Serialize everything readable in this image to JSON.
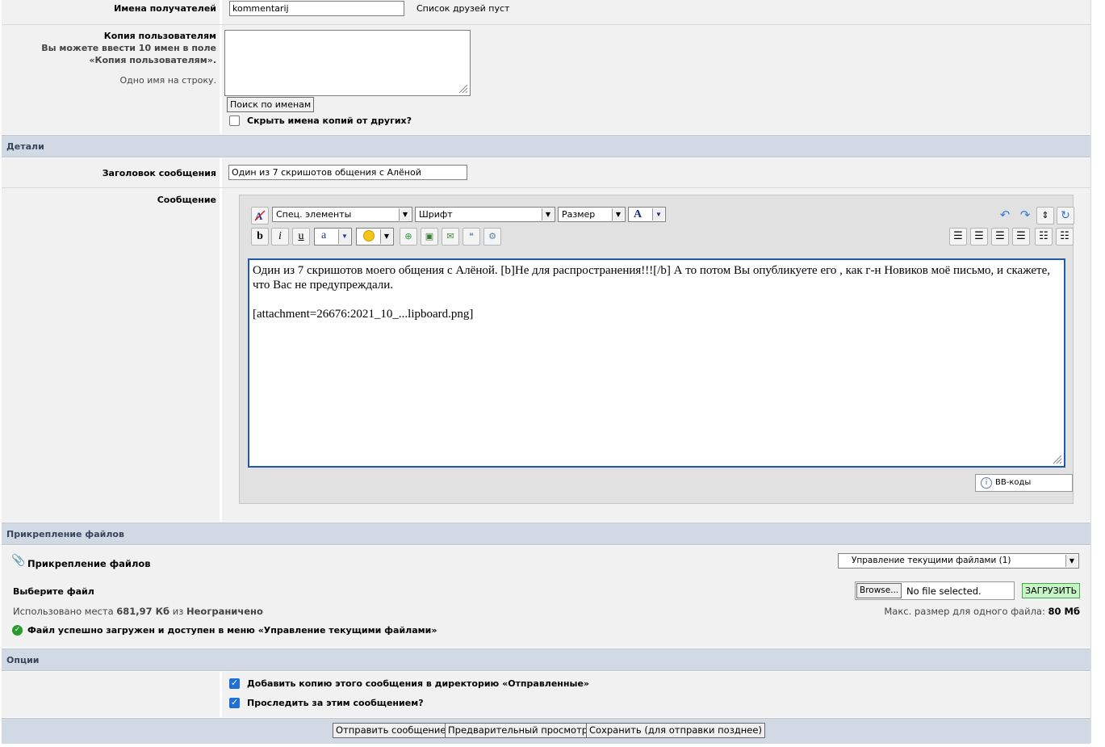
{
  "recipients": {
    "label": "Имена получателей",
    "value": "kommentarij",
    "friends_note": "Список друзей пуст"
  },
  "bcc": {
    "label": "Копия пользователям",
    "hint1": "Вы можете ввести 10 имен в поле «Копия пользователям».",
    "hint2": "Одно имя на строку.",
    "search_button": "Поиск по именам",
    "hide_label": "Скрыть имена копий от других?"
  },
  "details": {
    "section_title": "Детали",
    "subject_label": "Заголовок сообщения",
    "subject_value": "Один из 7 скришотов общения с Алёной",
    "message_label": "Сообщение"
  },
  "editor": {
    "special_select": "Спец. элементы",
    "font_select": "Шрифт",
    "size_select": "Размер",
    "text_line1": "Один из 7 скришотов моего общения с Алёной. [b]Не для распространения!!![/b] А то потом Вы опубликуете его , как г-н Новиков моё письмо, и скажете, что Вас не предупреждали.",
    "text_line2": "[attachment=26676:2021_10_...lipboard.png]",
    "bbcode_button": "BB-коды"
  },
  "attachments": {
    "section_title": "Прикрепление файлов",
    "header_label": "Прикрепление файлов",
    "manage_select": "Управление текущими файлами (1)",
    "choose_label": "Выберите файл",
    "browse_button": "Browse...",
    "file_status": "No file selected.",
    "upload_button": "ЗАГРУЗИТЬ",
    "used_prefix": "Использовано места",
    "used_value": "681,97 Кб",
    "used_mid": "из",
    "used_limit": "Неограничено",
    "max_prefix": "Макс. размер для одного файла:",
    "max_value": "80 Мб",
    "success_msg": "Файл успешно загружен и доступен в меню «Управление текущими файлами»"
  },
  "options": {
    "section_title": "Опции",
    "copy_label": "Добавить копию этого сообщения в директорию «Отправленные»",
    "track_label": "Проследить за этим сообщением?"
  },
  "footer": {
    "send_button": "Отправить сообщение",
    "preview_button": "Предварительный просмотр",
    "save_button": "Сохранить (для отправки позднее)"
  }
}
